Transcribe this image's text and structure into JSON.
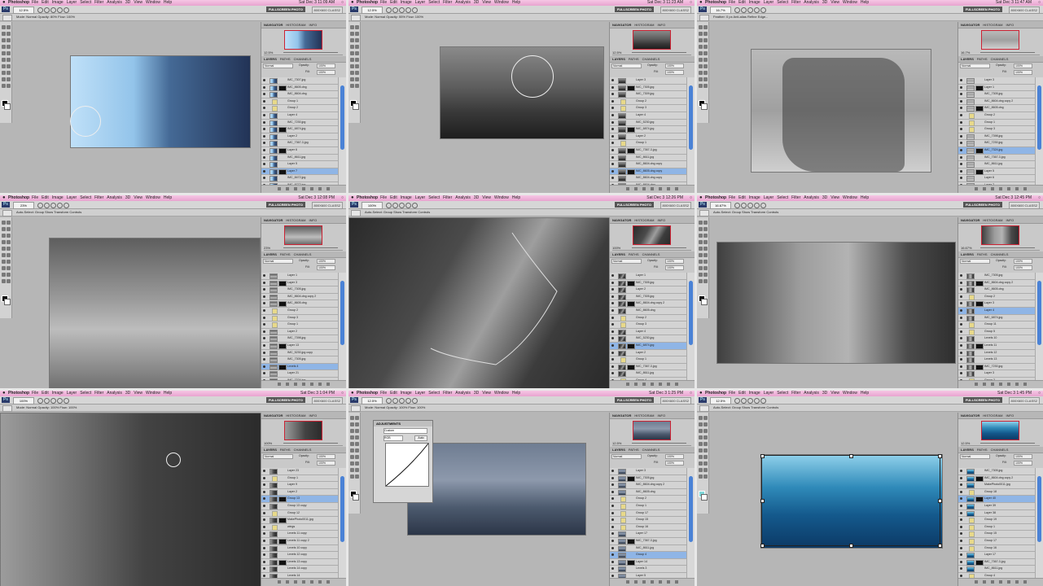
{
  "app": {
    "name": "Photoshop",
    "menu": [
      "File",
      "Edit",
      "Image",
      "Layer",
      "Select",
      "Filter",
      "Analysis",
      "3D",
      "View",
      "Window",
      "Help"
    ],
    "workspace_button": "FULLSCREEN PHOTO",
    "class_label": "800X600 CLASS2",
    "panel_tabs_top": [
      "NAVIGATOR",
      "HISTOGRAM",
      "INFO"
    ],
    "panel_tabs_layers": [
      "LAYERS",
      "PATHS",
      "CHANNELS"
    ],
    "blend_label": "Normal",
    "opacity_label": "Opacity:",
    "opacity_value": "100%",
    "fill_label": "Fill:",
    "fill_value": "100%"
  },
  "panels": [
    {
      "time": "Sat Dec 3 11:09 AM",
      "zoom": "12.5%",
      "options": "Mode:  Normal   Opacity: 80%   Flow: 100%",
      "canvas_bg": "linear-gradient(90deg,#bfe0f8 0%,#93c4ea 35%,#456a96 55%,#223356 100%)",
      "layers": [
        {
          "name": "IMC_7307.jpg"
        },
        {
          "name": "IMC_8605.dng"
        },
        {
          "name": "IMC_8604.dng"
        },
        {
          "name": "Group 1",
          "group": true
        },
        {
          "name": "Group 2",
          "group": true
        },
        {
          "name": "Layer 4"
        },
        {
          "name": "IMC_7230.jpg"
        },
        {
          "name": "IMC_6874.jpg"
        },
        {
          "name": "Layer 2"
        },
        {
          "name": "IMC_7367-3.jpg"
        },
        {
          "name": "Layer 6"
        },
        {
          "name": "IMC_8611.jpg"
        },
        {
          "name": "Layer 5"
        },
        {
          "name": "Layer 7",
          "selected": true
        },
        {
          "name": "IMC_8472.jpg"
        },
        {
          "name": "IMC_8772.jpg"
        }
      ]
    },
    {
      "time": "Sat Dec 3 11:23 AM",
      "zoom": "12.5%",
      "options": "Mode:  Normal   Opacity: 55%   Flow: 100%",
      "canvas_bg": "linear-gradient(180deg,#8a8a8a 0%,#5c5c5c 45%,#3a3a3a 70%,#1e1e1e 100%)",
      "layers": [
        {
          "name": "Layer 3"
        },
        {
          "name": "IMC_7305.jpg"
        },
        {
          "name": "IMC_7309.jpg"
        },
        {
          "name": "Group 2",
          "group": true
        },
        {
          "name": "Group 3",
          "group": true
        },
        {
          "name": "Layer 4"
        },
        {
          "name": "IMC_5230.jpg"
        },
        {
          "name": "IMC_6874.jpg"
        },
        {
          "name": "Layer 2"
        },
        {
          "name": "Group 1",
          "group": true
        },
        {
          "name": "IMC_7367-3.jpg"
        },
        {
          "name": "IMC_8611.jpg"
        },
        {
          "name": "IMC_8604.dng copy"
        },
        {
          "name": "IMC_8605.dng copy",
          "selected": true
        },
        {
          "name": "IMC_8604.dng copy"
        },
        {
          "name": "IMC_8604.dng"
        }
      ]
    },
    {
      "time": "Sat Dec 3 11:47 AM",
      "zoom": "16.7%",
      "options": "Feather: 0 px   Anti-alias   Refine Edge...",
      "canvas_bg": "linear-gradient(180deg,#b9b9b9 0%,#a0a0a0 50%,#cfcfcf 100%)",
      "layers": [
        {
          "name": "Layer 3"
        },
        {
          "name": "Layer 1"
        },
        {
          "name": "IMC_7305.jpg"
        },
        {
          "name": "IMC_8604.dng copy 2"
        },
        {
          "name": "IMC_8605.dng"
        },
        {
          "name": "Group 2",
          "group": true
        },
        {
          "name": "Group 1",
          "group": true
        },
        {
          "name": "Group 3",
          "group": true
        },
        {
          "name": "IMC_7398.jpg"
        },
        {
          "name": "IMC_7230.jpg"
        },
        {
          "name": "IMC_7324.jpg",
          "selected": true
        },
        {
          "name": "IMC_7367-3.jpg"
        },
        {
          "name": "IMC_8611.jpg"
        },
        {
          "name": "Layer 5"
        },
        {
          "name": "Layer 6"
        },
        {
          "name": "Layer 7"
        }
      ]
    },
    {
      "time": "Sat Dec 3 12:08 PM",
      "zoom": "23%",
      "options": "Auto-Select:  Group   Show Transform Controls",
      "canvas_bg": "linear-gradient(180deg,#5e5e5e 0%,#9a9a9a 40%,#bdbdbd 60%,#6e6e6e 100%)",
      "layers": [
        {
          "name": "Layer 1"
        },
        {
          "name": "Layer 3"
        },
        {
          "name": "IMC_7305.jpg"
        },
        {
          "name": "IMC_8604.dng copy 2"
        },
        {
          "name": "IMC_8605.dng"
        },
        {
          "name": "Group 2",
          "group": true
        },
        {
          "name": "Group 3",
          "group": true
        },
        {
          "name": "Group 1",
          "group": true
        },
        {
          "name": "Layer 2"
        },
        {
          "name": "IMC_7398.jpg"
        },
        {
          "name": "Layer 13"
        },
        {
          "name": "IMC_5230.jpg copy"
        },
        {
          "name": "IMC_7305.jpg"
        },
        {
          "name": "Levels 4",
          "selected": true
        },
        {
          "name": "Layer 21"
        },
        {
          "name": "IMC_7324.jpg"
        }
      ]
    },
    {
      "time": "Sat Dec 3 12:26 PM",
      "zoom": "100%",
      "options": "Auto-Select:  Group   Show Transform Controls",
      "canvas_bg": "linear-gradient(120deg,#2a2a2a 0%,#4b4b4b 35%,#9e9e9e 55%,#3c3c3c 75%,#2a2a2a 100%)",
      "layers": [
        {
          "name": "Layer 1"
        },
        {
          "name": "IMC_7305.jpg"
        },
        {
          "name": "Layer 2"
        },
        {
          "name": "IMC_7305.jpg"
        },
        {
          "name": "IMC_8604.dng copy 2"
        },
        {
          "name": "IMC_8605.dng"
        },
        {
          "name": "Group 2",
          "group": true
        },
        {
          "name": "Group 3",
          "group": true
        },
        {
          "name": "Layer 4"
        },
        {
          "name": "IMC_5230.jpg"
        },
        {
          "name": "IMC_6874.jpg",
          "selected": true
        },
        {
          "name": "Layer 2"
        },
        {
          "name": "Group 1",
          "group": true
        },
        {
          "name": "IMC_7367-3.jpg"
        },
        {
          "name": "IMC_8611.jpg"
        },
        {
          "name": "Group 4",
          "group": true
        }
      ]
    },
    {
      "time": "Sat Dec 3 12:45 PM",
      "zoom": "16.67%",
      "options": "Auto-Select:  Group   Show Transform Controls",
      "canvas_bg": "linear-gradient(90deg,#3f3f3f 0%,#9d9d9d 35%,#b3b3b3 55%,#4a4a4a 80%,#2f2f2f 100%)",
      "layers": [
        {
          "name": "IMC_7305.jpg"
        },
        {
          "name": "IMC_8604.dng copy 2"
        },
        {
          "name": "IMC_8605.dng"
        },
        {
          "name": "Group 2",
          "group": true
        },
        {
          "name": "Layer 3"
        },
        {
          "name": "Layer 4",
          "selected": true
        },
        {
          "name": "IMC_6874.jpg"
        },
        {
          "name": "Group 11",
          "group": true
        },
        {
          "name": "Group 5",
          "group": true
        },
        {
          "name": "Levels 10"
        },
        {
          "name": "Levels 11"
        },
        {
          "name": "Levels 12"
        },
        {
          "name": "Levels 13"
        },
        {
          "name": "IMC_7230.jpg"
        },
        {
          "name": "Layer 3"
        },
        {
          "name": "Group 2",
          "group": true
        }
      ]
    },
    {
      "time": "Sat Dec 3 1:04 PM",
      "zoom": "100%",
      "options": "Mode:  Normal   Opacity: 100%   Flow: 100%",
      "canvas_bg": "linear-gradient(90deg,#9c9c9c 0%,#6d6d6d 30%,#434343 55%,#2b2b2b 100%)",
      "layers": [
        {
          "name": "Layer 23"
        },
        {
          "name": "Group 1",
          "group": true
        },
        {
          "name": "Layer 9"
        },
        {
          "name": "Layer 2"
        },
        {
          "name": "Group 13",
          "selected": true
        },
        {
          "name": "Group 13 copy"
        },
        {
          "name": "Group 12",
          "group": true
        },
        {
          "name": "MakePhoto0011.jpg"
        },
        {
          "name": "wings",
          "group": true
        },
        {
          "name": "Levels 11 copy"
        },
        {
          "name": "Levels 11 copy 2"
        },
        {
          "name": "Levels 10 copy"
        },
        {
          "name": "Levels 12 copy"
        },
        {
          "name": "Levels 13 copy"
        },
        {
          "name": "Levels 14 copy"
        },
        {
          "name": "Levels 14"
        }
      ]
    },
    {
      "time": "Sat Dec 3 1:25 PM",
      "zoom": "12.5%",
      "options": "Mode:  Normal   Opacity: 100%   Flow: 100%",
      "canvas_bg": "linear-gradient(180deg,#6f7d92 0%,#8d99ac 40%,#4c5a6e 70%,#2c3648 100%)",
      "adjustments": {
        "title": "ADJUSTMENTS",
        "preset": "Custom",
        "channel": "RGB",
        "auto": "Auto"
      },
      "layers": [
        {
          "name": "Layer 3"
        },
        {
          "name": "IMC_7305.jpg"
        },
        {
          "name": "IMC_8604.dng copy 2"
        },
        {
          "name": "IMC_8605.dng"
        },
        {
          "name": "Group 2",
          "group": true
        },
        {
          "name": "Group 1",
          "group": true
        },
        {
          "name": "Group 17",
          "group": true
        },
        {
          "name": "Group 15",
          "group": true
        },
        {
          "name": "Group 16",
          "group": true
        },
        {
          "name": "Layer 17"
        },
        {
          "name": "IMC_7367-3.jpg"
        },
        {
          "name": "IMC_8611.jpg"
        },
        {
          "name": "Group 4",
          "selected": true
        },
        {
          "name": "Layer 14"
        },
        {
          "name": "Levels 3"
        },
        {
          "name": "Layer 5"
        }
      ]
    },
    {
      "time": "Sat Dec 3 1:45 PM",
      "zoom": "12.5%",
      "options": "Auto-Select:  Group   Show Transform Controls",
      "canvas_bg": "linear-gradient(180deg,#8fd0ea 0%,#2f8ab9 35%,#14598c 65%,#0c3a66 100%)",
      "layers": [
        {
          "name": "IMC_7305.jpg"
        },
        {
          "name": "IMC_8604.dng copy 2"
        },
        {
          "name": "MakePhoto0011.jpg"
        },
        {
          "name": "Group 18",
          "group": true
        },
        {
          "name": "Layer 40",
          "selected": true
        },
        {
          "name": "Layer 39"
        },
        {
          "name": "Layer 38"
        },
        {
          "name": "Group 19",
          "group": true
        },
        {
          "name": "Group 1",
          "group": true
        },
        {
          "name": "Group 15",
          "group": true
        },
        {
          "name": "Group 17",
          "group": true
        },
        {
          "name": "Group 16",
          "group": true
        },
        {
          "name": "Layer 17"
        },
        {
          "name": "IMC_7367-3.jpg"
        },
        {
          "name": "IMC_8611.jpg"
        },
        {
          "name": "Group 4",
          "group": true
        }
      ]
    }
  ]
}
